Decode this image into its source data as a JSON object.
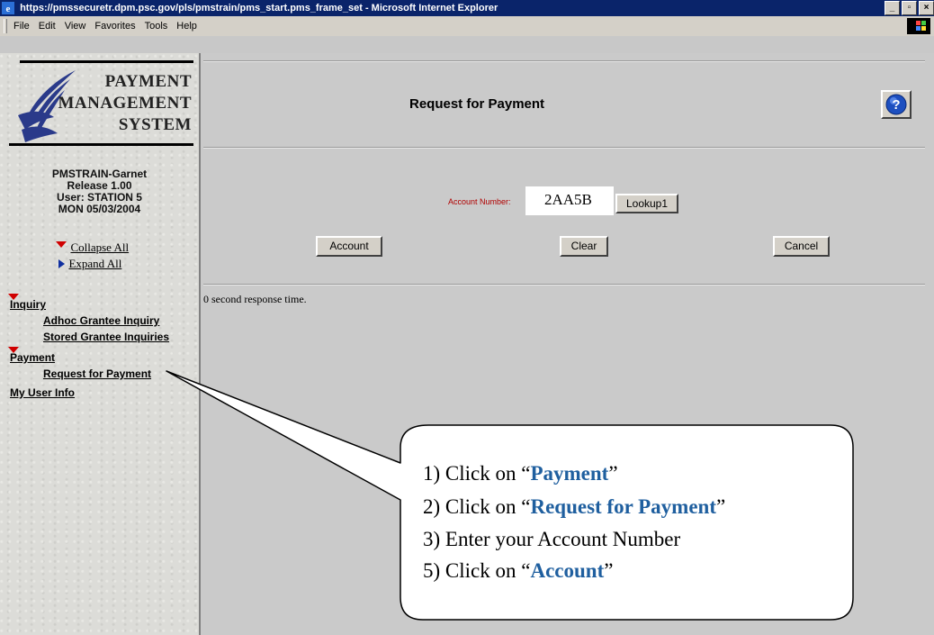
{
  "window": {
    "title": "https://pmssecuretr.dpm.psc.gov/pls/pmstrain/pms_start.pms_frame_set - Microsoft Internet Explorer",
    "controls": [
      "_",
      "▫",
      "×"
    ]
  },
  "menu": [
    "File",
    "Edit",
    "View",
    "Favorites",
    "Tools",
    "Help"
  ],
  "logo": {
    "line1": "PAYMENT",
    "line2": "MANAGEMENT",
    "line3": "SYSTEM"
  },
  "session": {
    "env": "PMSTRAIN-Garnet",
    "release": "Release 1.00",
    "user": "User: STATION 5",
    "date": "MON 05/03/2004"
  },
  "tree_controls": {
    "collapse": "Collapse All",
    "expand": "Expand All"
  },
  "nav": {
    "inquiry": "Inquiry",
    "adhoc": "Adhoc Grantee Inquiry",
    "stored": "Stored Grantee Inquiries",
    "payment": "Payment",
    "request": "Request for Payment",
    "myinfo": "My User Info"
  },
  "page": {
    "title": "Request for Payment",
    "help_icon": "help-question-icon",
    "account_label": "Account Number:",
    "account_value": "2AA5B",
    "lookup_btn": "Lookup1",
    "account_btn": "Account",
    "clear_btn": "Clear",
    "cancel_btn": "Cancel",
    "response": "0 second response time."
  },
  "callout": {
    "s1_pre": "1) Click on “",
    "s1_key": "Payment",
    "s1_post": "”",
    "s2_pre": "2) Click on “",
    "s2_key": "Request for Payment",
    "s2_post": "”",
    "s3": "3) Enter your Account Number",
    "s5_pre": "5) Click on “",
    "s5_key": "Account",
    "s5_post": "”"
  },
  "colors": {
    "titlebar": "#0a246a",
    "accent_text": "#1f5f9f",
    "label_red": "#b00000",
    "tree_red": "#d00000"
  }
}
